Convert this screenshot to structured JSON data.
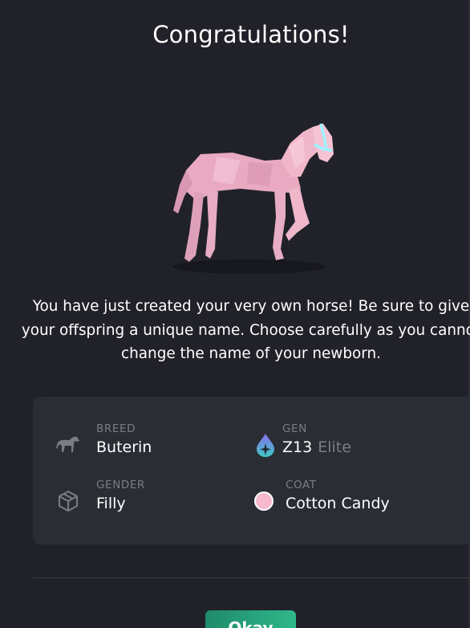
{
  "modal": {
    "title": "Congratulations!",
    "description": "You have just created your very own horse! Be sure to give your offspring a unique name. Choose carefully as you cannot change the name of your newborn."
  },
  "details": {
    "breed": {
      "label": "BREED",
      "value": "Buterin",
      "icon": "horse-icon"
    },
    "gen": {
      "label": "GEN",
      "value": "Z13",
      "tier": "Elite",
      "icon": "gen-drop-icon"
    },
    "gender": {
      "label": "GENDER",
      "value": "Filly",
      "icon": "cube-icon"
    },
    "coat": {
      "label": "COAT",
      "value": "Cotton Candy",
      "icon": "coat-swatch-icon",
      "swatch_color": "#f7b9cd"
    }
  },
  "actions": {
    "okay_label": "Okay"
  },
  "colors": {
    "background": "#212229",
    "card": "#2b2d35",
    "label": "#7b7d86",
    "button_start": "#1f8a6a",
    "button_end": "#2fb88a",
    "horse_coat": "#f2b6cc",
    "halter": "#9ff5ff"
  }
}
